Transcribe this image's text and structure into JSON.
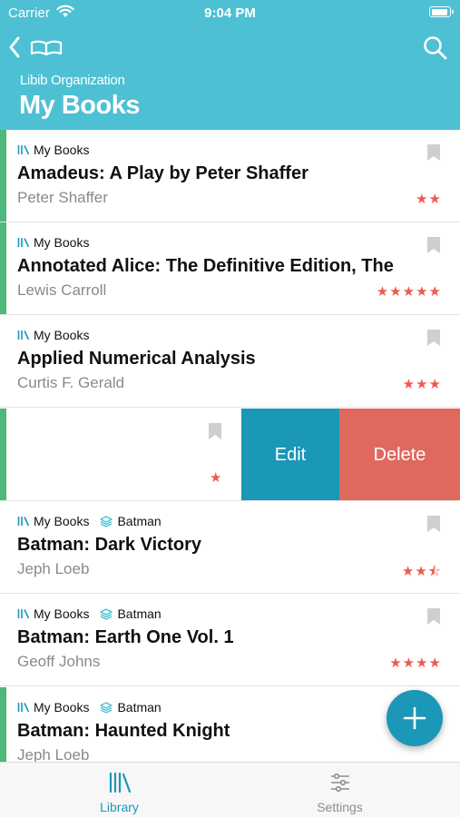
{
  "status_bar": {
    "carrier": "Carrier",
    "time": "9:04 PM"
  },
  "header": {
    "organization": "Libib Organization",
    "title": "My Books"
  },
  "books": [
    {
      "library": "My Books",
      "series": "",
      "title": "Amadeus: A Play by Peter Shaffer",
      "author": "Peter Shaffer",
      "stars": "★★",
      "rating": 2
    },
    {
      "library": "My Books",
      "series": "",
      "title": "Annotated Alice: The Definitive Edition, The",
      "author": "Lewis Carroll",
      "stars": "★★★★★",
      "rating": 5
    },
    {
      "library": "My Books",
      "series": "",
      "title": "Applied Numerical Analysis",
      "author": "Curtis F. Gerald",
      "stars": "★★★",
      "rating": 3
    },
    {
      "library": "My Books",
      "series": "Batman",
      "title": "Batman: Dark Victory",
      "author": "Jeph Loeb",
      "stars": "★★⯪",
      "rating": 2.5
    },
    {
      "library": "My Books",
      "series": "Batman",
      "title": "Batman: Earth One Vol. 1",
      "author": "Geoff Johns",
      "stars": "★★★★",
      "rating": 4
    },
    {
      "library": "My Books",
      "series": "Batman",
      "title": "Batman: Haunted Knight",
      "author": "Jeph Loeb",
      "stars": "",
      "rating": null
    }
  ],
  "swiped_row": {
    "stars": "★",
    "rating": 1,
    "edit_label": "Edit",
    "delete_label": "Delete"
  },
  "tabs": [
    {
      "label": "Library",
      "selected": true,
      "icon": "library-icon"
    },
    {
      "label": "Settings",
      "selected": false,
      "icon": "sliders-icon"
    }
  ],
  "colors": {
    "header": "#4dc0d4",
    "accent_bar": "#4db87a",
    "edit": "#1b97b8",
    "delete": "#e0695e",
    "stars": "#ef5a4c",
    "fab": "#1b97b8"
  }
}
